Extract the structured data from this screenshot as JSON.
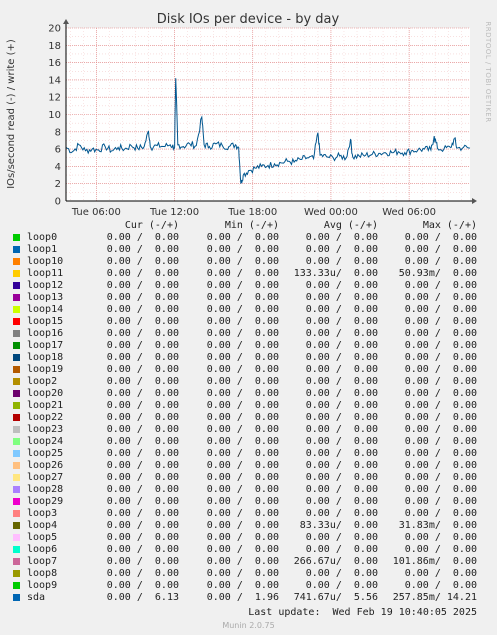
{
  "chart_data": {
    "type": "line",
    "title": "Disk IOs per device - by day",
    "ylabel": "IOs/second read (-) / write (+)",
    "ylim": [
      0,
      20
    ],
    "yticks": [
      0,
      2,
      4,
      6,
      8,
      10,
      12,
      14,
      16,
      18,
      20
    ],
    "x_range": [
      "Tue 03:40",
      "Wed 10:40"
    ],
    "xticks": [
      {
        "label": "Tue 06:00",
        "hours": 2.33
      },
      {
        "label": "Tue 12:00",
        "hours": 8.33
      },
      {
        "label": "Tue 18:00",
        "hours": 14.33
      },
      {
        "label": "Wed 00:00",
        "hours": 20.33
      },
      {
        "label": "Wed 06:00",
        "hours": 26.33
      }
    ],
    "grid": true,
    "series": [
      {
        "name": "sda",
        "color": "#00568f",
        "points": [
          [
            0,
            6.2
          ],
          [
            0.5,
            5.7
          ],
          [
            1.0,
            6.5
          ],
          [
            1.5,
            5.8
          ],
          [
            2.0,
            6.0
          ],
          [
            2.5,
            5.9
          ],
          [
            3.0,
            6.3
          ],
          [
            3.5,
            5.8
          ],
          [
            4.0,
            6.2
          ],
          [
            4.5,
            6.0
          ],
          [
            5.0,
            6.4
          ],
          [
            5.5,
            6.1
          ],
          [
            6.0,
            6.3
          ],
          [
            6.33,
            8.1
          ],
          [
            6.5,
            6.2
          ],
          [
            7.0,
            6.4
          ],
          [
            7.5,
            6.3
          ],
          [
            8.0,
            6.5
          ],
          [
            8.33,
            6.2
          ],
          [
            8.42,
            14.2
          ],
          [
            8.58,
            6.5
          ],
          [
            9.0,
            6.3
          ],
          [
            9.5,
            6.6
          ],
          [
            10.0,
            6.4
          ],
          [
            10.42,
            9.7
          ],
          [
            10.6,
            6.5
          ],
          [
            11.0,
            6.3
          ],
          [
            11.5,
            6.6
          ],
          [
            12.0,
            6.4
          ],
          [
            12.5,
            6.3
          ],
          [
            13.0,
            6.5
          ],
          [
            13.25,
            6.2
          ],
          [
            13.42,
            2.0
          ],
          [
            13.6,
            3.0
          ],
          [
            14.0,
            3.5
          ],
          [
            14.5,
            3.8
          ],
          [
            15.0,
            4.0
          ],
          [
            15.5,
            4.1
          ],
          [
            16.0,
            4.3
          ],
          [
            16.5,
            4.4
          ],
          [
            17.0,
            4.6
          ],
          [
            17.5,
            4.5
          ],
          [
            18.0,
            4.8
          ],
          [
            18.5,
            5.0
          ],
          [
            19.0,
            4.9
          ],
          [
            19.33,
            7.9
          ],
          [
            19.5,
            5.3
          ],
          [
            20.0,
            5.1
          ],
          [
            20.5,
            5.0
          ],
          [
            21.0,
            5.2
          ],
          [
            21.5,
            5.0
          ],
          [
            21.83,
            7.1
          ],
          [
            22.0,
            5.1
          ],
          [
            22.5,
            5.2
          ],
          [
            23.0,
            5.3
          ],
          [
            23.5,
            5.4
          ],
          [
            24.0,
            5.5
          ],
          [
            24.5,
            5.6
          ],
          [
            25.0,
            5.6
          ],
          [
            25.5,
            5.7
          ],
          [
            26.0,
            5.6
          ],
          [
            26.5,
            5.8
          ],
          [
            27.0,
            5.9
          ],
          [
            27.5,
            6.0
          ],
          [
            28.0,
            5.9
          ],
          [
            28.25,
            7.5
          ],
          [
            28.5,
            6.1
          ],
          [
            29.0,
            6.0
          ],
          [
            29.5,
            6.2
          ],
          [
            29.83,
            7.2
          ],
          [
            30.0,
            6.1
          ],
          [
            30.5,
            6.2
          ],
          [
            31.0,
            6.1
          ]
        ]
      }
    ]
  },
  "side_credit": "RRDTOOL / TOBI OETIKER",
  "legend": {
    "headers": {
      "cur": "Cur (-/+)",
      "min": "Min (-/+)",
      "avg": "Avg (-/+)",
      "max": "Max (-/+)"
    },
    "rows": [
      {
        "name": "loop0",
        "color": "#00cc00",
        "cur": "0.00 /  0.00",
        "min": "0.00 /  0.00",
        "avg": "0.00 /  0.00",
        "max": "0.00 /  0.00"
      },
      {
        "name": "loop1",
        "color": "#0066b3",
        "cur": "0.00 /  0.00",
        "min": "0.00 /  0.00",
        "avg": "0.00 /  0.00",
        "max": "0.00 /  0.00"
      },
      {
        "name": "loop10",
        "color": "#ff8000",
        "cur": "0.00 /  0.00",
        "min": "0.00 /  0.00",
        "avg": "0.00 /  0.00",
        "max": "0.00 /  0.00"
      },
      {
        "name": "loop11",
        "color": "#ffcc00",
        "cur": "0.00 /  0.00",
        "min": "0.00 /  0.00",
        "avg": "133.33u/  0.00",
        "max": "50.93m/  0.00"
      },
      {
        "name": "loop12",
        "color": "#330099",
        "cur": "0.00 /  0.00",
        "min": "0.00 /  0.00",
        "avg": "0.00 /  0.00",
        "max": "0.00 /  0.00"
      },
      {
        "name": "loop13",
        "color": "#990099",
        "cur": "0.00 /  0.00",
        "min": "0.00 /  0.00",
        "avg": "0.00 /  0.00",
        "max": "0.00 /  0.00"
      },
      {
        "name": "loop14",
        "color": "#ccff00",
        "cur": "0.00 /  0.00",
        "min": "0.00 /  0.00",
        "avg": "0.00 /  0.00",
        "max": "0.00 /  0.00"
      },
      {
        "name": "loop15",
        "color": "#ff0000",
        "cur": "0.00 /  0.00",
        "min": "0.00 /  0.00",
        "avg": "0.00 /  0.00",
        "max": "0.00 /  0.00"
      },
      {
        "name": "loop16",
        "color": "#808080",
        "cur": "0.00 /  0.00",
        "min": "0.00 /  0.00",
        "avg": "0.00 /  0.00",
        "max": "0.00 /  0.00"
      },
      {
        "name": "loop17",
        "color": "#008f00",
        "cur": "0.00 /  0.00",
        "min": "0.00 /  0.00",
        "avg": "0.00 /  0.00",
        "max": "0.00 /  0.00"
      },
      {
        "name": "loop18",
        "color": "#00487d",
        "cur": "0.00 /  0.00",
        "min": "0.00 /  0.00",
        "avg": "0.00 /  0.00",
        "max": "0.00 /  0.00"
      },
      {
        "name": "loop19",
        "color": "#b35a00",
        "cur": "0.00 /  0.00",
        "min": "0.00 /  0.00",
        "avg": "0.00 /  0.00",
        "max": "0.00 /  0.00"
      },
      {
        "name": "loop2",
        "color": "#b38f00",
        "cur": "0.00 /  0.00",
        "min": "0.00 /  0.00",
        "avg": "0.00 /  0.00",
        "max": "0.00 /  0.00"
      },
      {
        "name": "loop20",
        "color": "#6b006b",
        "cur": "0.00 /  0.00",
        "min": "0.00 /  0.00",
        "avg": "0.00 /  0.00",
        "max": "0.00 /  0.00"
      },
      {
        "name": "loop21",
        "color": "#8fb300",
        "cur": "0.00 /  0.00",
        "min": "0.00 /  0.00",
        "avg": "0.00 /  0.00",
        "max": "0.00 /  0.00"
      },
      {
        "name": "loop22",
        "color": "#b30000",
        "cur": "0.00 /  0.00",
        "min": "0.00 /  0.00",
        "avg": "0.00 /  0.00",
        "max": "0.00 /  0.00"
      },
      {
        "name": "loop23",
        "color": "#bebebe",
        "cur": "0.00 /  0.00",
        "min": "0.00 /  0.00",
        "avg": "0.00 /  0.00",
        "max": "0.00 /  0.00"
      },
      {
        "name": "loop24",
        "color": "#80ff80",
        "cur": "0.00 /  0.00",
        "min": "0.00 /  0.00",
        "avg": "0.00 /  0.00",
        "max": "0.00 /  0.00"
      },
      {
        "name": "loop25",
        "color": "#80c9ff",
        "cur": "0.00 /  0.00",
        "min": "0.00 /  0.00",
        "avg": "0.00 /  0.00",
        "max": "0.00 /  0.00"
      },
      {
        "name": "loop26",
        "color": "#ffc080",
        "cur": "0.00 /  0.00",
        "min": "0.00 /  0.00",
        "avg": "0.00 /  0.00",
        "max": "0.00 /  0.00"
      },
      {
        "name": "loop27",
        "color": "#ffe680",
        "cur": "0.00 /  0.00",
        "min": "0.00 /  0.00",
        "avg": "0.00 /  0.00",
        "max": "0.00 /  0.00"
      },
      {
        "name": "loop28",
        "color": "#aa80ff",
        "cur": "0.00 /  0.00",
        "min": "0.00 /  0.00",
        "avg": "0.00 /  0.00",
        "max": "0.00 /  0.00"
      },
      {
        "name": "loop29",
        "color": "#ee00cc",
        "cur": "0.00 /  0.00",
        "min": "0.00 /  0.00",
        "avg": "0.00 /  0.00",
        "max": "0.00 /  0.00"
      },
      {
        "name": "loop3",
        "color": "#ff8080",
        "cur": "0.00 /  0.00",
        "min": "0.00 /  0.00",
        "avg": "0.00 /  0.00",
        "max": "0.00 /  0.00"
      },
      {
        "name": "loop4",
        "color": "#666600",
        "cur": "0.00 /  0.00",
        "min": "0.00 /  0.00",
        "avg": "83.33u/  0.00",
        "max": "31.83m/  0.00"
      },
      {
        "name": "loop5",
        "color": "#ffbfff",
        "cur": "0.00 /  0.00",
        "min": "0.00 /  0.00",
        "avg": "0.00 /  0.00",
        "max": "0.00 /  0.00"
      },
      {
        "name": "loop6",
        "color": "#00ffcc",
        "cur": "0.00 /  0.00",
        "min": "0.00 /  0.00",
        "avg": "0.00 /  0.00",
        "max": "0.00 /  0.00"
      },
      {
        "name": "loop7",
        "color": "#cc6699",
        "cur": "0.00 /  0.00",
        "min": "0.00 /  0.00",
        "avg": "266.67u/  0.00",
        "max": "101.86m/  0.00"
      },
      {
        "name": "loop8",
        "color": "#999900",
        "cur": "0.00 /  0.00",
        "min": "0.00 /  0.00",
        "avg": "0.00 /  0.00",
        "max": "0.00 /  0.00"
      },
      {
        "name": "loop9",
        "color": "#00cc00",
        "cur": "0.00 /  0.00",
        "min": "0.00 /  0.00",
        "avg": "0.00 /  0.00",
        "max": "0.00 /  0.00"
      },
      {
        "name": "sda",
        "color": "#0066b3",
        "cur": "0.00 /  6.13",
        "min": "0.00 /  1.96",
        "avg": "741.67u/  5.56",
        "max": "257.85m/ 14.21"
      }
    ]
  },
  "last_update": "Last update:  Wed Feb 19 10:40:05 2025",
  "version": "Munin 2.0.75"
}
